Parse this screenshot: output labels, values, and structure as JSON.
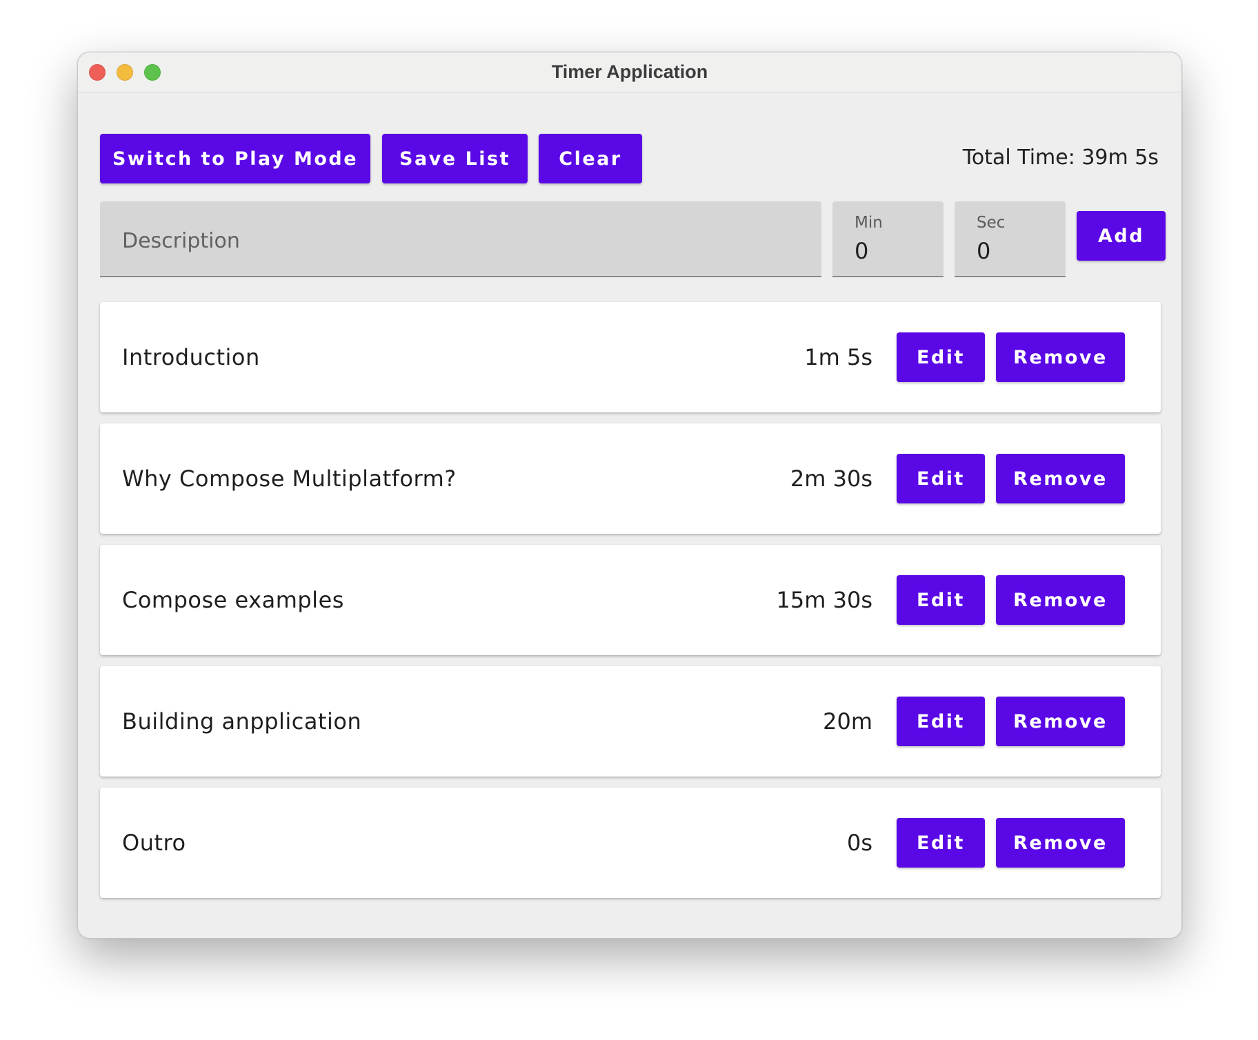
{
  "window": {
    "title": "Timer Application"
  },
  "toolbar": {
    "play_mode_label": "Switch to Play Mode",
    "save_label": "Save List",
    "clear_label": "Clear",
    "total_time": "Total Time: 39m 5s"
  },
  "form": {
    "description_placeholder": "Description",
    "min_label": "Min",
    "min_value": "0",
    "sec_label": "Sec",
    "sec_value": "0",
    "add_label": "Add"
  },
  "items": [
    {
      "description": "Introduction",
      "time": "1m 5s",
      "edit_label": "Edit",
      "remove_label": "Remove"
    },
    {
      "description": "Why Compose Multiplatform?",
      "time": "2m 30s",
      "edit_label": "Edit",
      "remove_label": "Remove"
    },
    {
      "description": "Compose examples",
      "time": "15m 30s",
      "edit_label": "Edit",
      "remove_label": "Remove"
    },
    {
      "description": "Building anpplication",
      "time": "20m",
      "edit_label": "Edit",
      "remove_label": "Remove"
    },
    {
      "description": "Outro",
      "time": "0s",
      "edit_label": "Edit",
      "remove_label": "Remove"
    }
  ],
  "colors": {
    "accent": "#5a08e6",
    "window_bg": "#eeeeee",
    "card_bg": "#ffffff",
    "field_bg": "#d6d6d6"
  }
}
